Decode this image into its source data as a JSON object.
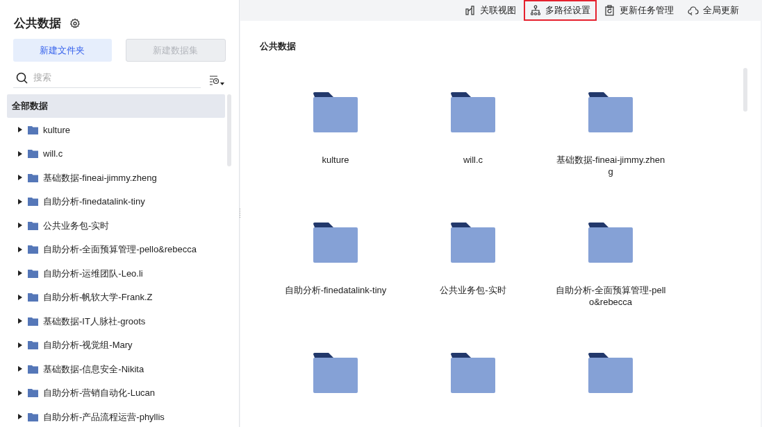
{
  "sidebar": {
    "title": "公共数据",
    "buttons": [
      {
        "label": "新建文件夹",
        "disabled": false
      },
      {
        "label": "新建数据集",
        "disabled": true
      }
    ],
    "search": {
      "placeholder": "搜索"
    },
    "tree": {
      "root": {
        "label": "全部数据",
        "selected": true
      },
      "items": [
        {
          "label": "kulture",
          "expanded": false
        },
        {
          "label": "will.c",
          "expanded": false
        },
        {
          "label": "基础数据-fineai-jimmy.zheng",
          "expanded": false
        },
        {
          "label": "自助分析-finedatalink-tiny",
          "expanded": false
        },
        {
          "label": "公共业务包-实时",
          "expanded": false
        },
        {
          "label": "自助分析-全面预算管理-pello&rebecca",
          "expanded": false
        },
        {
          "label": "自助分析-运维团队-Leo.li",
          "expanded": false
        },
        {
          "label": "自助分析-帆软大学-Frank.Z",
          "expanded": false
        },
        {
          "label": "基础数据-IT人脉社-groots",
          "expanded": false
        },
        {
          "label": "自助分析-视觉组-Mary",
          "expanded": false
        },
        {
          "label": "基础数据-信息安全-Nikita",
          "expanded": false
        },
        {
          "label": "自助分析-营销自动化-Lucan",
          "expanded": false
        },
        {
          "label": "自助分析-产品流程运营-phyllis",
          "expanded": false
        }
      ]
    }
  },
  "toolbar": [
    {
      "kind": "relation",
      "label": "关联视图",
      "highlighted": false
    },
    {
      "kind": "paths",
      "label": "多路径设置",
      "highlighted": true
    },
    {
      "kind": "tasks",
      "label": "更新任务管理",
      "highlighted": false
    },
    {
      "kind": "refresh",
      "label": "全局更新",
      "highlighted": false
    }
  ],
  "content": {
    "breadcrumb": "公共数据",
    "items": [
      {
        "kind": "folder",
        "name": "kulture"
      },
      {
        "kind": "folder",
        "name": "will.c"
      },
      {
        "kind": "folder",
        "name": "基础数据-fineai-jimmy.zheng"
      },
      {
        "kind": "folder",
        "name": "自助分析-finedatalink-tiny"
      },
      {
        "kind": "folder",
        "name": "公共业务包-实时"
      },
      {
        "kind": "folder",
        "name": "自助分析-全面预算管理-pello&rebecca"
      },
      {
        "kind": "folder"
      },
      {
        "kind": "folder"
      },
      {
        "kind": "folder"
      }
    ]
  }
}
